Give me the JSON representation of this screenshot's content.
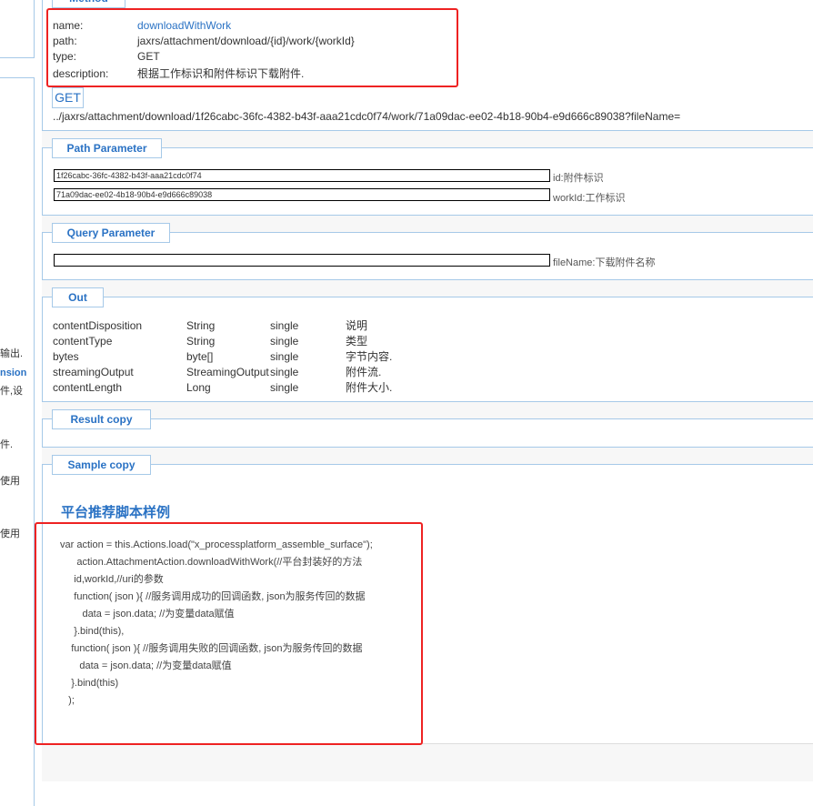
{
  "sidebar": {
    "fragments": [
      "输出.",
      "nsion",
      "件,设",
      "件.",
      "使用",
      "使用"
    ]
  },
  "method": {
    "legend": "Method",
    "name_label": "name:",
    "name": "downloadWithWork",
    "path_label": "path:",
    "path": "jaxrs/attachment/download/{id}/work/{workId}",
    "type_label": "type:",
    "type": "GET",
    "description_label": "description:",
    "description": "根据工作标识和附件标识下载附件.",
    "get_button": "GET",
    "url": "../jaxrs/attachment/download/1f26cabc-36fc-4382-b43f-aaa21cdc0f74/work/71a09dac-ee02-4b18-90b4-e9d666c89038?fileName="
  },
  "path_parameter": {
    "legend": "Path Parameter",
    "params": [
      {
        "value": "1f26cabc-36fc-4382-b43f-aaa21cdc0f74",
        "label": "id:附件标识"
      },
      {
        "value": "71a09dac-ee02-4b18-90b4-e9d666c89038",
        "label": "workId:工作标识"
      }
    ]
  },
  "query_parameter": {
    "legend": "Query Parameter",
    "params": [
      {
        "value": "",
        "label": "fileName:下载附件名称"
      }
    ]
  },
  "out": {
    "legend": "Out",
    "rows": [
      {
        "name": "contentDisposition",
        "type": "String",
        "mult": "single",
        "desc": "说明"
      },
      {
        "name": "contentType",
        "type": "String",
        "mult": "single",
        "desc": "类型"
      },
      {
        "name": "bytes",
        "type": "byte[]",
        "mult": "single",
        "desc": "字节内容."
      },
      {
        "name": "streamingOutput",
        "type": "StreamingOutput",
        "mult": "single",
        "desc": "附件流."
      },
      {
        "name": "contentLength",
        "type": "Long",
        "mult": "single",
        "desc": "附件大小."
      }
    ]
  },
  "result": {
    "legend": "Result copy"
  },
  "sample": {
    "legend": "Sample copy",
    "heading": "平台推荐脚本样例",
    "code": [
      "var action = this.Actions.load(\"x_processplatform_assemble_surface\");",
      "      action.AttachmentAction.downloadWithWork(//平台封装好的方法",
      "     id,workId,//uri的参数",
      "     function( json ){ //服务调用成功的回调函数, json为服务传回的数据",
      "        data = json.data; //为变量data赋值",
      "     }.bind(this),",
      "    function( json ){ //服务调用失败的回调函数, json为服务传回的数据",
      "       data = json.data; //为变量data赋值",
      "    }.bind(this)",
      "   );"
    ]
  }
}
